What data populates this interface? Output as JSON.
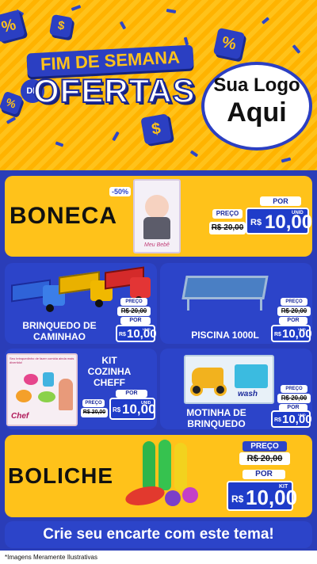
{
  "header": {
    "title_top": "FIM DE SEMANA",
    "title_connector": "DE",
    "title_main": "OFERTAS",
    "logo_line1": "Sua Logo",
    "logo_line2": "Aqui",
    "symbols": [
      "%",
      "$",
      "%",
      "$",
      "%"
    ]
  },
  "products": [
    {
      "name": "BONECA",
      "discount": "-50%",
      "old_label": "PREÇO",
      "old_price": "R$ 20,00",
      "new_label": "POR",
      "currency": "R$",
      "price": "10,00",
      "unit": "UNID"
    },
    {
      "name": "BRINQUEDO DE CAMINHAO",
      "old_label": "PREÇO",
      "old_price": "R$ 20,00",
      "new_label": "POR",
      "currency": "R$",
      "price": "10,00",
      "unit": "UNID"
    },
    {
      "name": "PISCINA 1000L",
      "old_label": "PREÇO",
      "old_price": "R$ 20,00",
      "new_label": "POR",
      "currency": "R$",
      "price": "10,00",
      "unit": "UNID"
    },
    {
      "name": "KIT COZINHA CHEFF",
      "old_label": "PREÇO",
      "old_price": "R$ 20,00",
      "new_label": "POR",
      "currency": "R$",
      "price": "10,00",
      "unit": "UNID"
    },
    {
      "name": "MOTINHA DE BRINQUEDO",
      "old_label": "PREÇO",
      "old_price": "R$ 20,00",
      "new_label": "POR",
      "currency": "R$",
      "price": "10,00",
      "unit": "UNID"
    },
    {
      "name": "BOLICHE",
      "old_label": "PREÇO",
      "old_price": "R$ 20,00",
      "new_label": "POR",
      "currency": "R$",
      "price": "10,00",
      "unit": "KIT"
    }
  ],
  "product_art_text": {
    "doll_box": "Meu Bebê",
    "kitchen_box_top": "Seu brinquedinho de fazer comida ainda mais divertido!",
    "kitchen_box_brand": "Chef",
    "moto_box_brand": "wash"
  },
  "cta": "Crie seu encarte com este tema!",
  "disclaimer": "*Imagens Meramente Ilustrativas",
  "colors": {
    "yellow": "#ffc21a",
    "blue": "#2c44c9",
    "dark_blue": "#1b2a9b",
    "white": "#ffffff"
  }
}
